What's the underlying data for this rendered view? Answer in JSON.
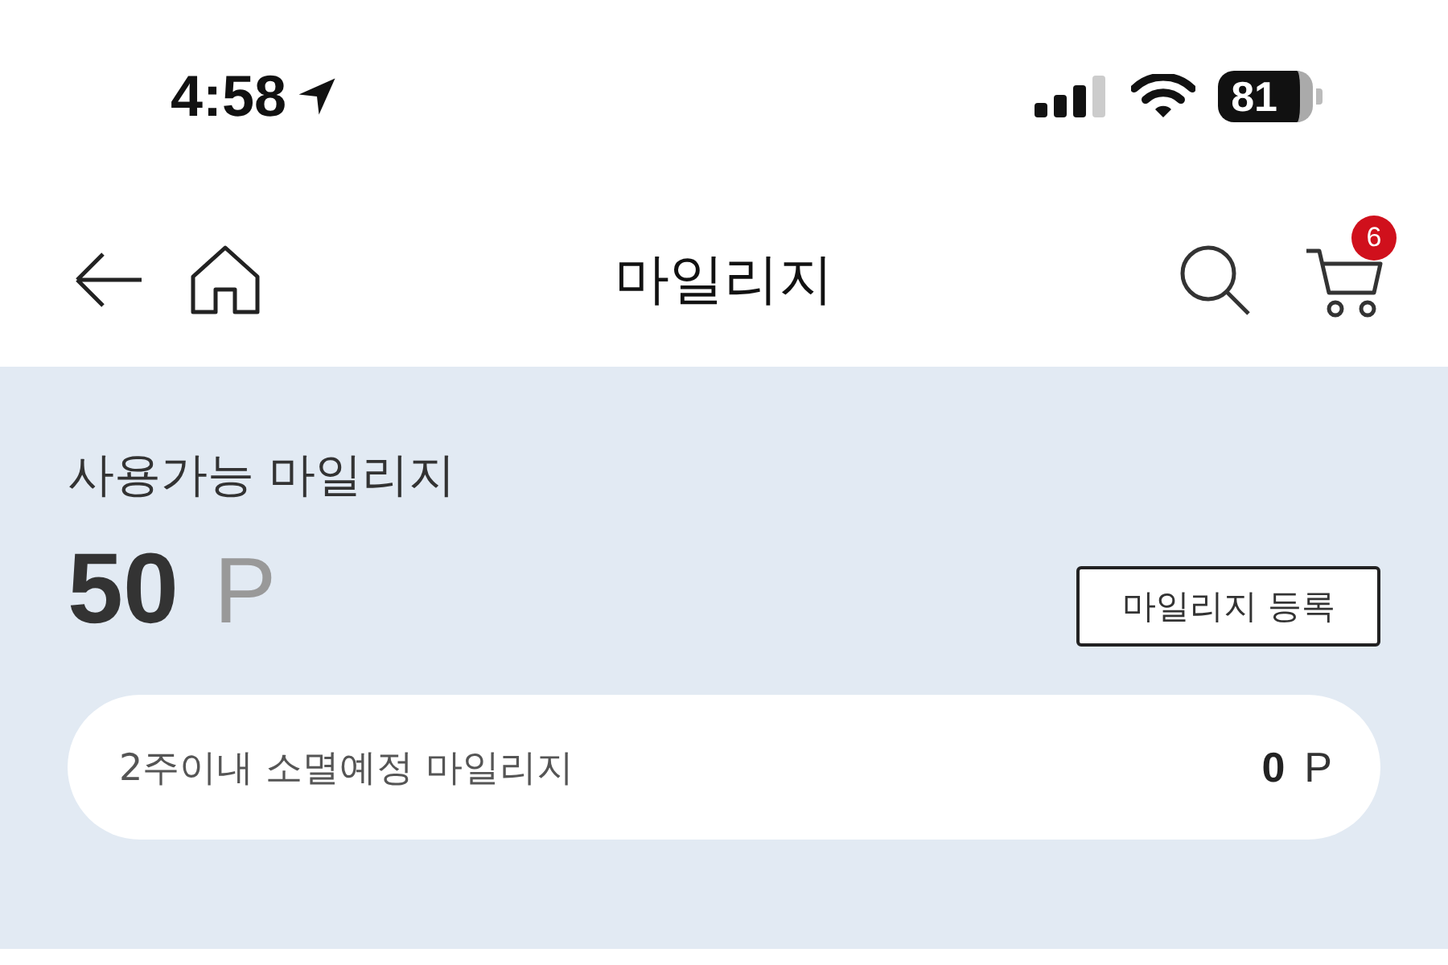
{
  "status_bar": {
    "time": "4:58",
    "battery": "81"
  },
  "header": {
    "title": "마일리지",
    "cart_count": "6"
  },
  "mileage": {
    "label": "사용가능 마일리지",
    "amount": "50",
    "unit": "P",
    "register_button": "마일리지 등록"
  },
  "expiring": {
    "label": "2주이내 소멸예정 마일리지",
    "amount": "0",
    "unit": "P"
  }
}
